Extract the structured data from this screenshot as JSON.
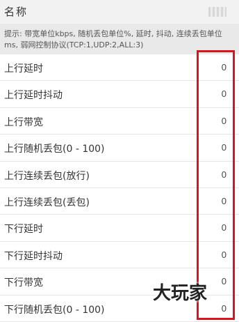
{
  "header": {
    "title": "名称",
    "icon": "blurred-icon"
  },
  "hint": {
    "text": "提示: 带宽单位kbps, 随机丢包单位%, 延时, 抖动, 连续丢包单位ms, 弱网控制协议(TCP:1,UDP:2,ALL:3)"
  },
  "rows": [
    {
      "label": "上行延时",
      "value": "0"
    },
    {
      "label": "上行延时抖动",
      "value": "0"
    },
    {
      "label": "上行带宽",
      "value": "0"
    },
    {
      "label": "上行随机丢包(0 - 100)",
      "value": "0"
    },
    {
      "label": "上行连续丢包(放行)",
      "value": "0"
    },
    {
      "label": "上行连续丢包(丢包)",
      "value": "0"
    },
    {
      "label": "下行延时",
      "value": "0"
    },
    {
      "label": "下行延时抖动",
      "value": "0"
    },
    {
      "label": "下行带宽",
      "value": "0"
    },
    {
      "label": "下行随机丢包(0 - 100)",
      "value": "0"
    }
  ],
  "watermark": {
    "text": "大玩家"
  },
  "colors": {
    "highlight": "#d9141c",
    "header_bg": "#f2f2f2",
    "hint_bg": "#e9e9e9"
  }
}
